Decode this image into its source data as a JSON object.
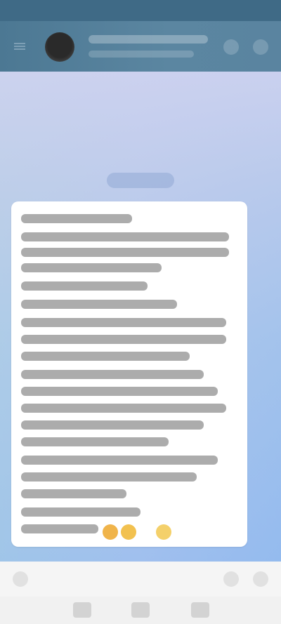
{
  "status_bar": {},
  "header": {
    "back_icon": "back-arrow-icon",
    "avatar": "contact-avatar",
    "icons": [
      "call-icon",
      "more-icon"
    ]
  },
  "chat": {
    "date_chip": "",
    "message": {
      "emojis": [
        "emoji-1",
        "emoji-2",
        "emoji-3"
      ]
    }
  },
  "composer": {
    "icons": [
      "emoji-icon",
      "attach-icon",
      "mic-icon"
    ]
  },
  "nav_bar": {
    "buttons": [
      "recent-apps-button",
      "home-button",
      "back-button"
    ]
  },
  "colors": {
    "header": "#4c7893",
    "status_bar": "#3f6a86",
    "bubble": "#ffffff",
    "chat_bg_start": "#cdd2ef",
    "chat_bg_end": "#8fb3ef"
  }
}
